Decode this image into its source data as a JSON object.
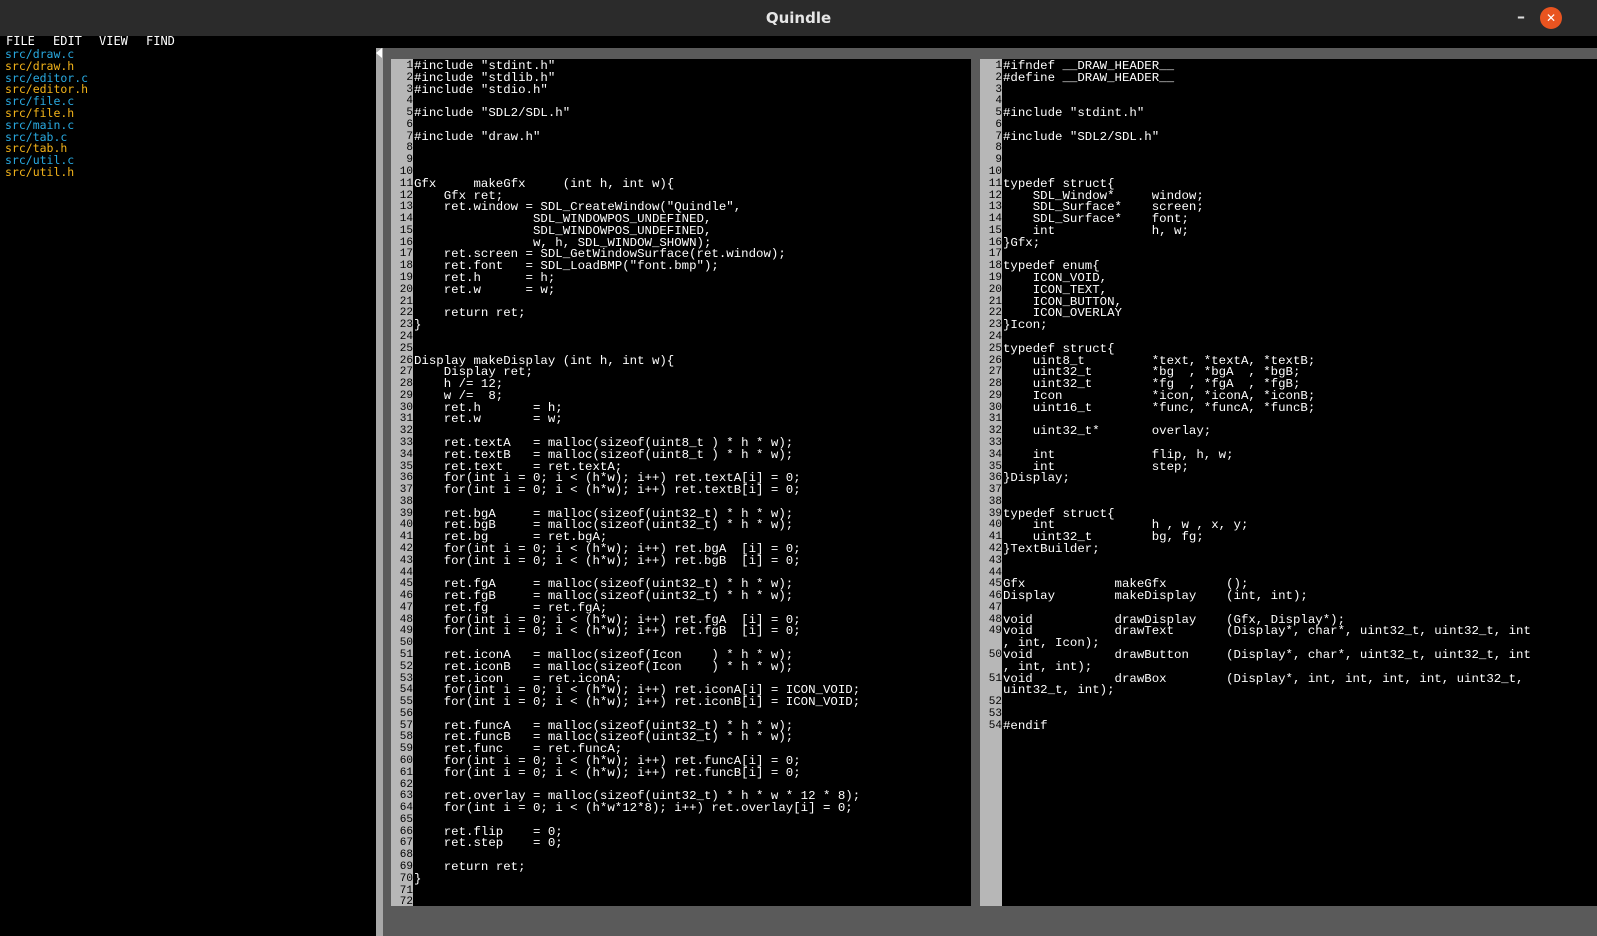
{
  "window": {
    "title": "Quindle",
    "minimize_glyph": "–",
    "close_glyph": "✕"
  },
  "menu": [
    "FILE",
    "EDIT",
    "VIEW",
    "FIND"
  ],
  "files": [
    {
      "name": "src/draw.c",
      "kind": "c"
    },
    {
      "name": "src/draw.h",
      "kind": "h"
    },
    {
      "name": "src/editor.c",
      "kind": "c"
    },
    {
      "name": "src/editor.h",
      "kind": "h"
    },
    {
      "name": "src/file.c",
      "kind": "c"
    },
    {
      "name": "src/file.h",
      "kind": "h"
    },
    {
      "name": "src/main.c",
      "kind": "c"
    },
    {
      "name": "src/tab.c",
      "kind": "c"
    },
    {
      "name": "src/tab.h",
      "kind": "h"
    },
    {
      "name": "src/util.c",
      "kind": "c"
    },
    {
      "name": "src/util.h",
      "kind": "h"
    }
  ],
  "colors": {
    "c_file": "#29a9e0",
    "h_file": "#f2b31a",
    "close_button": "#e95420",
    "gutter": "#b7b7b7"
  },
  "panes": [
    {
      "file": "src/draw.c",
      "lines": [
        {
          "n": "1",
          "t": "#include \"stdint.h\""
        },
        {
          "n": "2",
          "t": "#include \"stdlib.h\""
        },
        {
          "n": "3",
          "t": "#include \"stdio.h\""
        },
        {
          "n": "4",
          "t": ""
        },
        {
          "n": "5",
          "t": "#include \"SDL2/SDL.h\""
        },
        {
          "n": "6",
          "t": ""
        },
        {
          "n": "7",
          "t": "#include \"draw.h\""
        },
        {
          "n": "8",
          "t": ""
        },
        {
          "n": "9",
          "t": ""
        },
        {
          "n": "10",
          "t": ""
        },
        {
          "n": "11",
          "t": "Gfx     makeGfx     (int h, int w){"
        },
        {
          "n": "12",
          "t": "    Gfx ret;"
        },
        {
          "n": "13",
          "t": "    ret.window = SDL_CreateWindow(\"Quindle\","
        },
        {
          "n": "14",
          "t": "                SDL_WINDOWPOS_UNDEFINED,"
        },
        {
          "n": "15",
          "t": "                SDL_WINDOWPOS_UNDEFINED,"
        },
        {
          "n": "16",
          "t": "                w, h, SDL_WINDOW_SHOWN);"
        },
        {
          "n": "17",
          "t": "    ret.screen = SDL_GetWindowSurface(ret.window);"
        },
        {
          "n": "18",
          "t": "    ret.font   = SDL_LoadBMP(\"font.bmp\");"
        },
        {
          "n": "19",
          "t": "    ret.h      = h;"
        },
        {
          "n": "20",
          "t": "    ret.w      = w;"
        },
        {
          "n": "21",
          "t": ""
        },
        {
          "n": "22",
          "t": "    return ret;"
        },
        {
          "n": "23",
          "t": "}"
        },
        {
          "n": "24",
          "t": ""
        },
        {
          "n": "25",
          "t": ""
        },
        {
          "n": "26",
          "t": "Display makeDisplay (int h, int w){"
        },
        {
          "n": "27",
          "t": "    Display ret;"
        },
        {
          "n": "28",
          "t": "    h /= 12;"
        },
        {
          "n": "29",
          "t": "    w /=  8;"
        },
        {
          "n": "30",
          "t": "    ret.h       = h;"
        },
        {
          "n": "31",
          "t": "    ret.w       = w;"
        },
        {
          "n": "32",
          "t": ""
        },
        {
          "n": "33",
          "t": "    ret.textA   = malloc(sizeof(uint8_t ) * h * w);"
        },
        {
          "n": "34",
          "t": "    ret.textB   = malloc(sizeof(uint8_t ) * h * w);"
        },
        {
          "n": "35",
          "t": "    ret.text    = ret.textA;"
        },
        {
          "n": "36",
          "t": "    for(int i = 0; i < (h*w); i++) ret.textA[i] = 0;"
        },
        {
          "n": "37",
          "t": "    for(int i = 0; i < (h*w); i++) ret.textB[i] = 0;"
        },
        {
          "n": "38",
          "t": ""
        },
        {
          "n": "39",
          "t": "    ret.bgA     = malloc(sizeof(uint32_t) * h * w);"
        },
        {
          "n": "40",
          "t": "    ret.bgB     = malloc(sizeof(uint32_t) * h * w);"
        },
        {
          "n": "41",
          "t": "    ret.bg      = ret.bgA;"
        },
        {
          "n": "42",
          "t": "    for(int i = 0; i < (h*w); i++) ret.bgA  [i] = 0;"
        },
        {
          "n": "43",
          "t": "    for(int i = 0; i < (h*w); i++) ret.bgB  [i] = 0;"
        },
        {
          "n": "44",
          "t": ""
        },
        {
          "n": "45",
          "t": "    ret.fgA     = malloc(sizeof(uint32_t) * h * w);"
        },
        {
          "n": "46",
          "t": "    ret.fgB     = malloc(sizeof(uint32_t) * h * w);"
        },
        {
          "n": "47",
          "t": "    ret.fg      = ret.fgA;"
        },
        {
          "n": "48",
          "t": "    for(int i = 0; i < (h*w); i++) ret.fgA  [i] = 0;"
        },
        {
          "n": "49",
          "t": "    for(int i = 0; i < (h*w); i++) ret.fgB  [i] = 0;"
        },
        {
          "n": "50",
          "t": ""
        },
        {
          "n": "51",
          "t": "    ret.iconA   = malloc(sizeof(Icon    ) * h * w);"
        },
        {
          "n": "52",
          "t": "    ret.iconB   = malloc(sizeof(Icon    ) * h * w);"
        },
        {
          "n": "53",
          "t": "    ret.icon    = ret.iconA;"
        },
        {
          "n": "54",
          "t": "    for(int i = 0; i < (h*w); i++) ret.iconA[i] = ICON_VOID;"
        },
        {
          "n": "55",
          "t": "    for(int i = 0; i < (h*w); i++) ret.iconB[i] = ICON_VOID;"
        },
        {
          "n": "56",
          "t": ""
        },
        {
          "n": "57",
          "t": "    ret.funcA   = malloc(sizeof(uint32_t) * h * w);"
        },
        {
          "n": "58",
          "t": "    ret.funcB   = malloc(sizeof(uint32_t) * h * w);"
        },
        {
          "n": "59",
          "t": "    ret.func    = ret.funcA;"
        },
        {
          "n": "60",
          "t": "    for(int i = 0; i < (h*w); i++) ret.funcA[i] = 0;"
        },
        {
          "n": "61",
          "t": "    for(int i = 0; i < (h*w); i++) ret.funcB[i] = 0;"
        },
        {
          "n": "62",
          "t": ""
        },
        {
          "n": "63",
          "t": "    ret.overlay = malloc(sizeof(uint32_t) * h * w * 12 * 8);"
        },
        {
          "n": "64",
          "t": "    for(int i = 0; i < (h*w*12*8); i++) ret.overlay[i] = 0;"
        },
        {
          "n": "65",
          "t": ""
        },
        {
          "n": "66",
          "t": "    ret.flip    = 0;"
        },
        {
          "n": "67",
          "t": "    ret.step    = 0;"
        },
        {
          "n": "68",
          "t": ""
        },
        {
          "n": "69",
          "t": "    return ret;"
        },
        {
          "n": "70",
          "t": "}"
        },
        {
          "n": "71",
          "t": ""
        },
        {
          "n": "72",
          "t": ""
        }
      ]
    },
    {
      "file": "src/draw.h",
      "lines": [
        {
          "n": "1",
          "t": "#ifndef __DRAW_HEADER__"
        },
        {
          "n": "2",
          "t": "#define __DRAW_HEADER__"
        },
        {
          "n": "3",
          "t": ""
        },
        {
          "n": "4",
          "t": ""
        },
        {
          "n": "5",
          "t": "#include \"stdint.h\""
        },
        {
          "n": "6",
          "t": ""
        },
        {
          "n": "7",
          "t": "#include \"SDL2/SDL.h\""
        },
        {
          "n": "8",
          "t": ""
        },
        {
          "n": "9",
          "t": ""
        },
        {
          "n": "10",
          "t": ""
        },
        {
          "n": "11",
          "t": "typedef struct{"
        },
        {
          "n": "12",
          "t": "    SDL_Window*     window;"
        },
        {
          "n": "13",
          "t": "    SDL_Surface*    screen;"
        },
        {
          "n": "14",
          "t": "    SDL_Surface*    font;"
        },
        {
          "n": "15",
          "t": "    int             h, w;"
        },
        {
          "n": "16",
          "t": "}Gfx;"
        },
        {
          "n": "17",
          "t": ""
        },
        {
          "n": "18",
          "t": "typedef enum{"
        },
        {
          "n": "19",
          "t": "    ICON_VOID,"
        },
        {
          "n": "20",
          "t": "    ICON_TEXT,"
        },
        {
          "n": "21",
          "t": "    ICON_BUTTON,"
        },
        {
          "n": "22",
          "t": "    ICON_OVERLAY"
        },
        {
          "n": "23",
          "t": "}Icon;"
        },
        {
          "n": "24",
          "t": ""
        },
        {
          "n": "25",
          "t": "typedef struct{"
        },
        {
          "n": "26",
          "t": "    uint8_t         *text, *textA, *textB;"
        },
        {
          "n": "27",
          "t": "    uint32_t        *bg  , *bgA  , *bgB;"
        },
        {
          "n": "28",
          "t": "    uint32_t        *fg  , *fgA  , *fgB;"
        },
        {
          "n": "29",
          "t": "    Icon            *icon, *iconA, *iconB;"
        },
        {
          "n": "30",
          "t": "    uint16_t        *func, *funcA, *funcB;"
        },
        {
          "n": "31",
          "t": ""
        },
        {
          "n": "32",
          "t": "    uint32_t*       overlay;"
        },
        {
          "n": "33",
          "t": ""
        },
        {
          "n": "34",
          "t": "    int             flip, h, w;"
        },
        {
          "n": "35",
          "t": "    int             step;"
        },
        {
          "n": "36",
          "t": "}Display;"
        },
        {
          "n": "37",
          "t": ""
        },
        {
          "n": "38",
          "t": ""
        },
        {
          "n": "39",
          "t": "typedef struct{"
        },
        {
          "n": "40",
          "t": "    int             h , w , x, y;"
        },
        {
          "n": "41",
          "t": "    uint32_t        bg, fg;"
        },
        {
          "n": "42",
          "t": "}TextBuilder;"
        },
        {
          "n": "43",
          "t": ""
        },
        {
          "n": "44",
          "t": ""
        },
        {
          "n": "45",
          "t": "Gfx            makeGfx        ();"
        },
        {
          "n": "46",
          "t": "Display        makeDisplay    (int, int);"
        },
        {
          "n": "47",
          "t": ""
        },
        {
          "n": "48",
          "t": "void           drawDisplay    (Gfx, Display*);"
        },
        {
          "n": "49",
          "t": "void           drawText       (Display*, char*, uint32_t, uint32_t, int"
        },
        {
          "n": "",
          "t": ", int, Icon);"
        },
        {
          "n": "50",
          "t": "void           drawButton     (Display*, char*, uint32_t, uint32_t, int"
        },
        {
          "n": "",
          "t": ", int, int);"
        },
        {
          "n": "51",
          "t": "void           drawBox        (Display*, int, int, int, int, uint32_t,"
        },
        {
          "n": "",
          "t": "uint32_t, int);"
        },
        {
          "n": "52",
          "t": ""
        },
        {
          "n": "53",
          "t": ""
        },
        {
          "n": "54",
          "t": "#endif"
        }
      ]
    }
  ]
}
